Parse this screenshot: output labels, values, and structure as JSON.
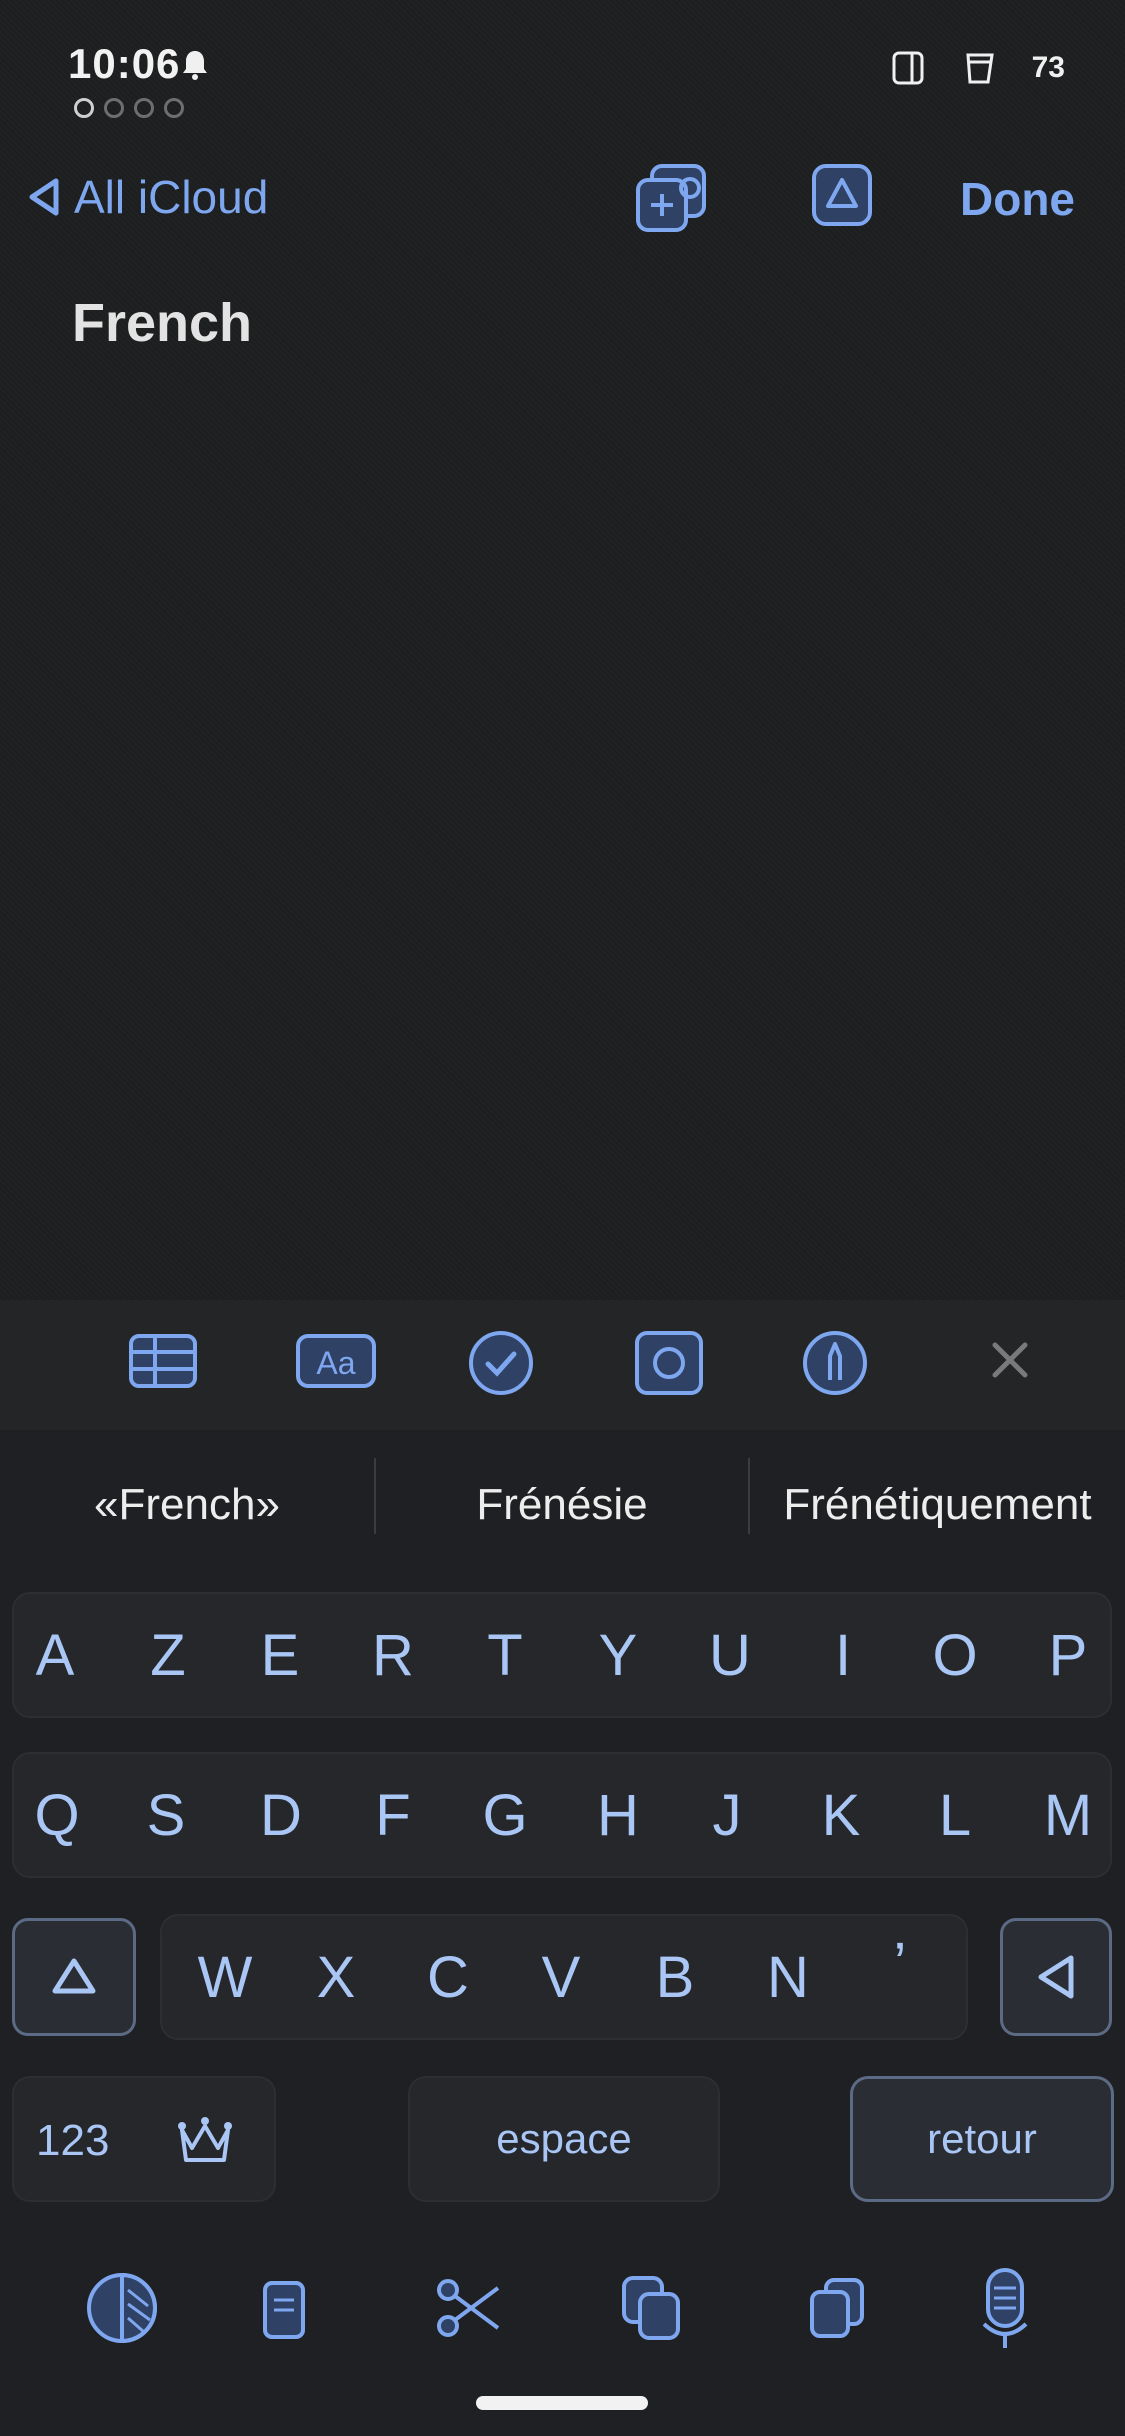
{
  "status": {
    "time": "10:06",
    "battery": "73",
    "icons": [
      "bell-icon",
      "screen-icon",
      "cup-icon"
    ]
  },
  "nav": {
    "back_label": "All iCloud",
    "done_label": "Done",
    "icons": [
      "add-collaborator-icon",
      "share-icon"
    ]
  },
  "note": {
    "title": "French"
  },
  "toolbar": {
    "icons": [
      "table-icon",
      "text-format-icon",
      "checklist-icon",
      "camera-icon",
      "markup-icon",
      "close-icon"
    ]
  },
  "keyboard": {
    "suggestions": [
      "«French»",
      "Frénésie",
      "Frénétiquement"
    ],
    "row1": [
      "A",
      "Z",
      "E",
      "R",
      "T",
      "Y",
      "U",
      "I",
      "O",
      "P"
    ],
    "row2": [
      "Q",
      "S",
      "D",
      "F",
      "G",
      "H",
      "J",
      "K",
      "L",
      "M"
    ],
    "row3": [
      "W",
      "X",
      "C",
      "V",
      "B",
      "N",
      "’"
    ],
    "numbers_label": "123",
    "space_label": "espace",
    "return_label": "retour"
  },
  "bottom_bar": {
    "icons": [
      "theme-icon",
      "clipboard-icon",
      "cut-icon",
      "copy-icon",
      "paste-icon",
      "microphone-icon"
    ]
  },
  "colors": {
    "accent": "#7ea7f0",
    "key_text": "#a9c6f5",
    "background": "#1c1e1f"
  }
}
